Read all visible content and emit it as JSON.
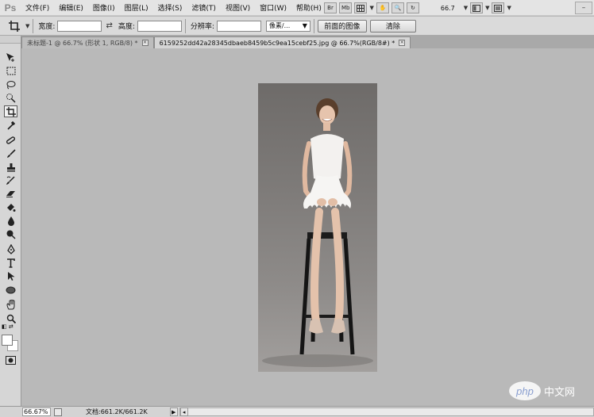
{
  "app": {
    "logo_text": "Ps"
  },
  "menu": {
    "items": [
      "文件(F)",
      "编辑(E)",
      "图像(I)",
      "图层(L)",
      "选择(S)",
      "滤镜(T)",
      "视图(V)",
      "窗口(W)",
      "帮助(H)"
    ],
    "br_label": "Br",
    "mb_label": "Mb",
    "zoom_value": "66.7"
  },
  "options": {
    "width_label": "宽度:",
    "width_value": "",
    "height_label": "高度:",
    "height_value": "",
    "resolution_label": "分辨率:",
    "resolution_value": "",
    "unit_select": "像素/...",
    "front_image_button": "前面的图像",
    "clear_button": "清除"
  },
  "tabs": [
    {
      "title": "未标题-1 @ 66.7% (形状 1, RGB/8) *",
      "active": false
    },
    {
      "title": "6159252dd42a28345dbaeb8459b5c9ea15cebf25.jpg @ 66.7%(RGB/8#) *",
      "active": true
    }
  ],
  "toolbox": {
    "tools": [
      "move-tool",
      "marquee-tool",
      "lasso-tool",
      "quick-select-tool",
      "crop-tool",
      "eyedropper-tool",
      "healing-brush-tool",
      "brush-tool",
      "clone-stamp-tool",
      "history-brush-tool",
      "eraser-tool",
      "paint-bucket-tool",
      "blur-tool",
      "dodge-tool",
      "pen-tool",
      "type-tool",
      "path-select-tool",
      "ellipse-tool",
      "hand-tool",
      "zoom-tool"
    ],
    "active_tool": "crop-tool",
    "foreground_color": "#ffffff",
    "background_color": "#ffffff"
  },
  "status": {
    "zoom": "66.67%",
    "doc_info": "文档:661.2K/661.2K"
  },
  "watermark": {
    "logo": "php",
    "text": "中文网"
  },
  "colors": {
    "canvas_bg": "#b9b9b9",
    "panel_bg": "#d6d6d6"
  }
}
